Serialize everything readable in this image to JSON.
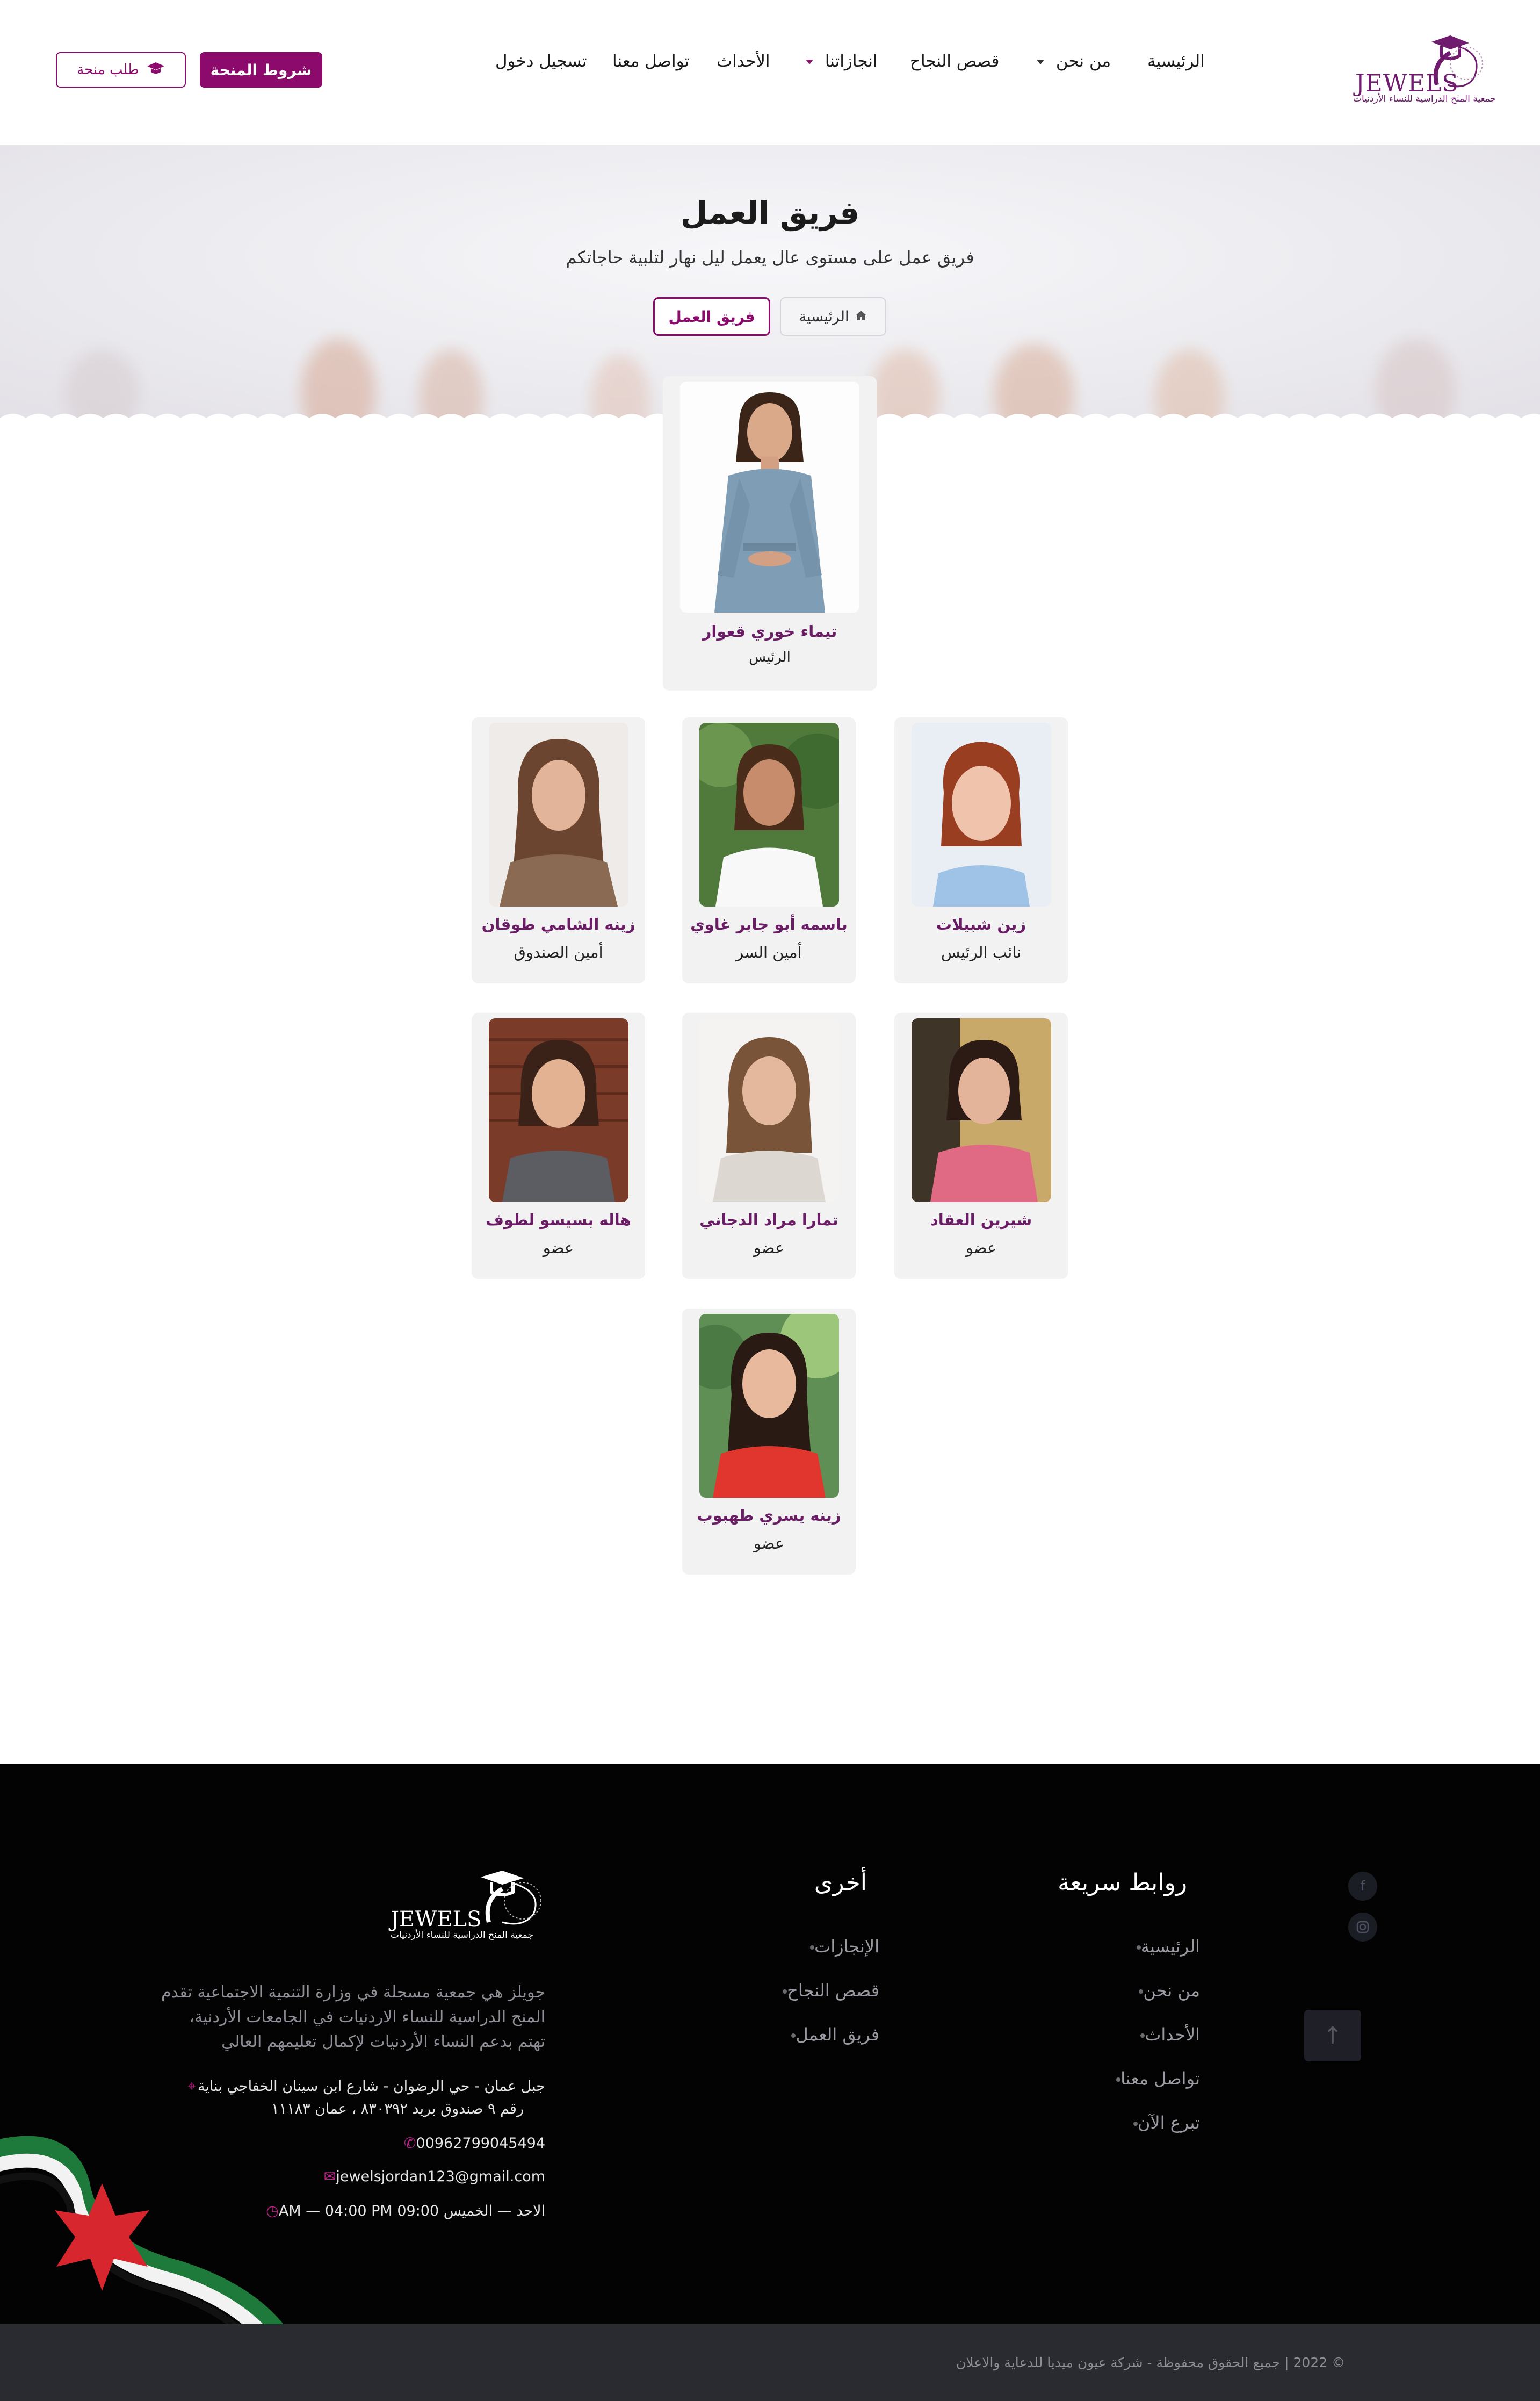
{
  "header": {
    "logo_text": "JEWELS",
    "logo_subtitle": "جمعية المنح الدراسية للنساء الأردنيات",
    "nav": {
      "home": "الرئيسية",
      "about": "من نحن",
      "success": "قصص النجاح",
      "achievements": "انجازاتنا",
      "events": "الأحداث",
      "contact": "تواصل معنا",
      "login": "تسجيل دخول"
    },
    "terms_button": "شروط المنحة",
    "apply_button": "طلب منحة",
    "apply_icon": "graduation-cap-icon"
  },
  "hero": {
    "title": "فريق العمل",
    "subtitle": "فريق عمل على مستوى عال يعمل ليل نهار لتلبية حاجاتكم",
    "breadcrumb_home": "الرئيسية",
    "breadcrumb_home_icon": "home-icon",
    "breadcrumb_current": "فريق العمل"
  },
  "team": [
    {
      "name": "تيماء خوري قعوار",
      "role": "الرئيس"
    },
    {
      "name": "زين شبيلات",
      "role": "نائب الرئيس"
    },
    {
      "name": "باسمه أبو جابر غاوي",
      "role": "أمين السر"
    },
    {
      "name": "زينه الشامي طوقان",
      "role": "أمين الصندوق"
    },
    {
      "name": "شيرين العقاد",
      "role": "عضو"
    },
    {
      "name": "تمارا مراد الدجاني",
      "role": "عضو"
    },
    {
      "name": "هاله بسيسو لطوف",
      "role": "عضو"
    },
    {
      "name": "زينه يسري طهبوب",
      "role": "عضو"
    }
  ],
  "footer": {
    "quick_links_title": "روابط سريعة",
    "quick_links": [
      "الرئيسية",
      "من نحن",
      "الأحداث",
      "تواصل معنا",
      "تبرع الآن"
    ],
    "other_title": "أخرى",
    "other_links": [
      "الإنجازات",
      "قصص النجاح",
      "فريق العمل"
    ],
    "logo_text": "JEWELS",
    "logo_subtitle": "جمعية المنح الدراسية للنساء الأردنيات",
    "about_lines": [
      "جويلز هي جمعية مسجلة في وزارة التنمية الاجتماعية تقدم",
      "المنح الدراسية للنساء الاردنيات في الجامعات الأردنية،",
      "تهتم بدعم النساء الأردنيات لإكمال تعليمهم العالي"
    ],
    "address_line1": "جبل عمان - حي الرضوان - شارع ابن سينان الخفاجي بناية",
    "address_line2": "رقم ٩ صندوق بريد ٨٣٠٣٩٢ ، عمان ١١١٨٣",
    "phone": "00962799045494",
    "email": "jewelsjordan123@gmail.com",
    "hours": "الاحد — الخميس 09:00 AM — 04:00 PM",
    "social": [
      "facebook-icon",
      "instagram-icon"
    ],
    "copyright": "© 2022 | جميع الحقوق محفوظة - شركة عيون ميديا للدعاية والاعلان"
  },
  "colors": {
    "brand": "#8b0a6c",
    "name_purple": "#6a1c65",
    "footer_bg": "#030303",
    "bottom_bar": "#2a2b30"
  }
}
